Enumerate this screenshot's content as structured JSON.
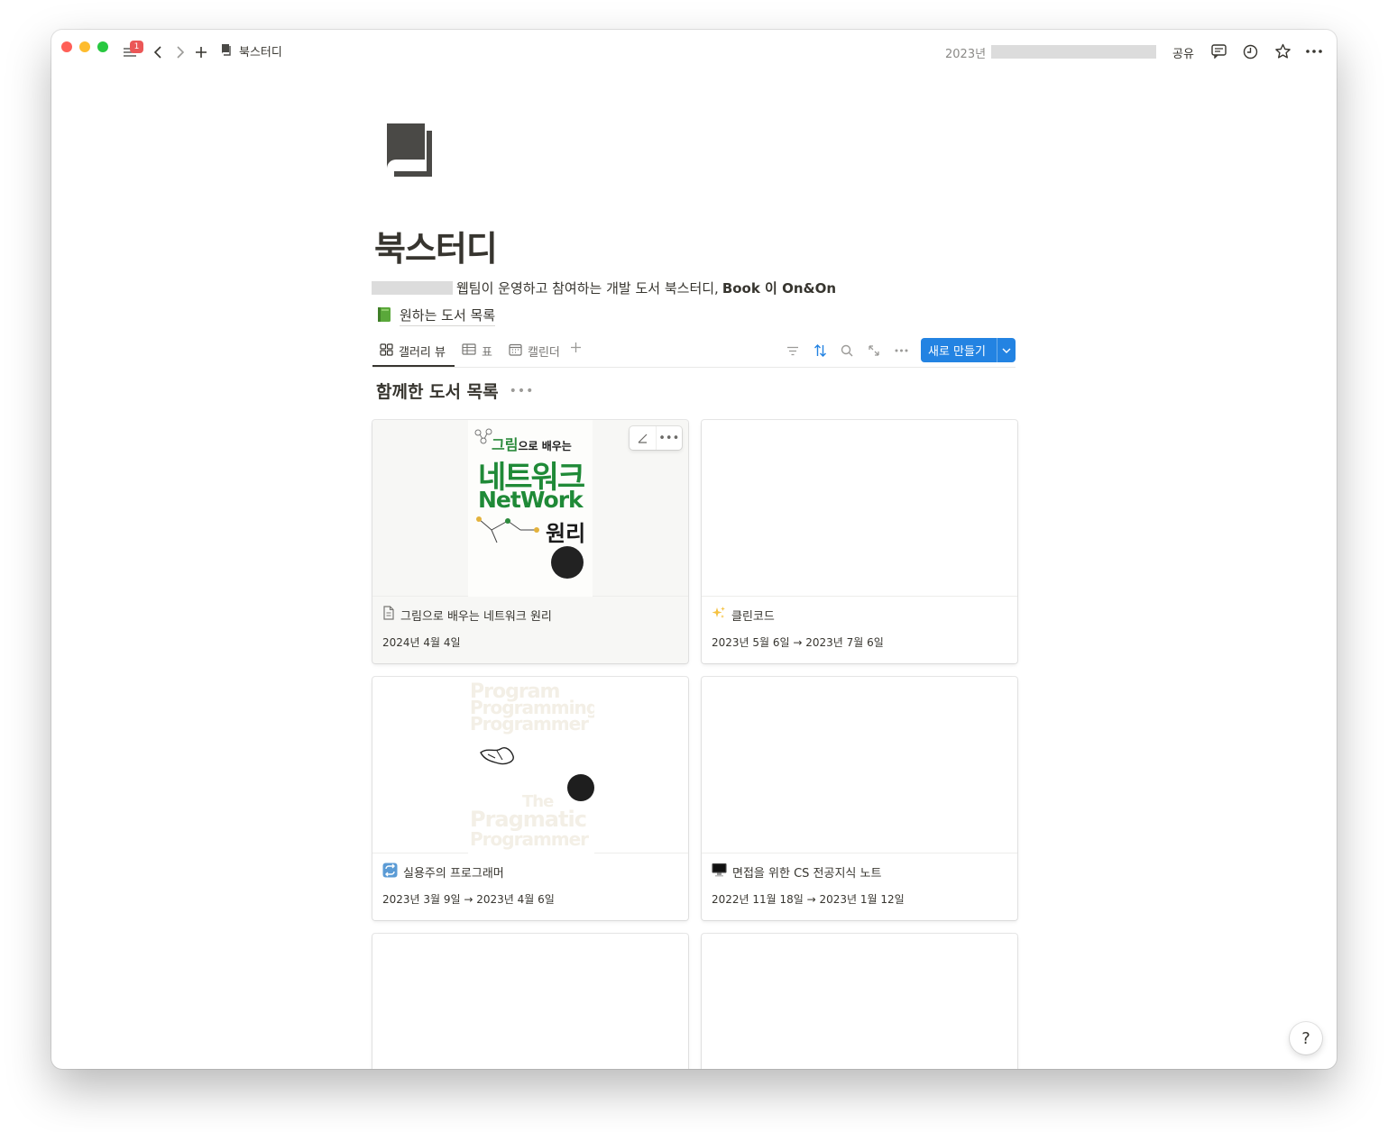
{
  "titlebar": {
    "notification_count": "1",
    "breadcrumb": "북스터디",
    "date_prefix": "2023년",
    "share_label": "공유"
  },
  "page": {
    "title": "북스터디",
    "description": "웹팀이 운영하고 참여하는 개발 도서 북스터디,",
    "description_bold": "Book 이 On&On",
    "link_label": "원하는 도서 목록"
  },
  "views": {
    "tabs": [
      {
        "label": "갤러리 뷰",
        "icon": "gallery-icon"
      },
      {
        "label": "표",
        "icon": "table-icon"
      },
      {
        "label": "캘린더",
        "icon": "calendar-icon"
      }
    ],
    "new_button": "새로 만들기"
  },
  "group": {
    "title": "함께한 도서 목록"
  },
  "cards": [
    {
      "title": "그림으로 배우는 네트워크 원리",
      "date": "2024년 4월 4일",
      "icon": "page-icon"
    },
    {
      "title": "클린코드",
      "date": "2023년 5월 6일 → 2023년 7월 6일",
      "icon": "sparkles-icon"
    },
    {
      "title": "실용주의 프로그래머",
      "date": "2023년 3월 9일 → 2023년 4월 6일",
      "icon": "repeat-icon"
    },
    {
      "title": "면접을 위한 CS 전공지식 노트",
      "date": "2022년 11월 18일 → 2023년 1월 12일",
      "icon": "desktop-computer-icon"
    }
  ],
  "covers": {
    "network": {
      "line1a": "그림",
      "line1b": "으로 배우는",
      "line2": "네트워크",
      "line3": "NetWork",
      "line4": "원리"
    },
    "pragmatic": {
      "words": [
        "Program",
        "Programming",
        "Programmer",
        "The",
        "Pragmatic",
        "Programmer"
      ]
    }
  },
  "help_label": "?"
}
